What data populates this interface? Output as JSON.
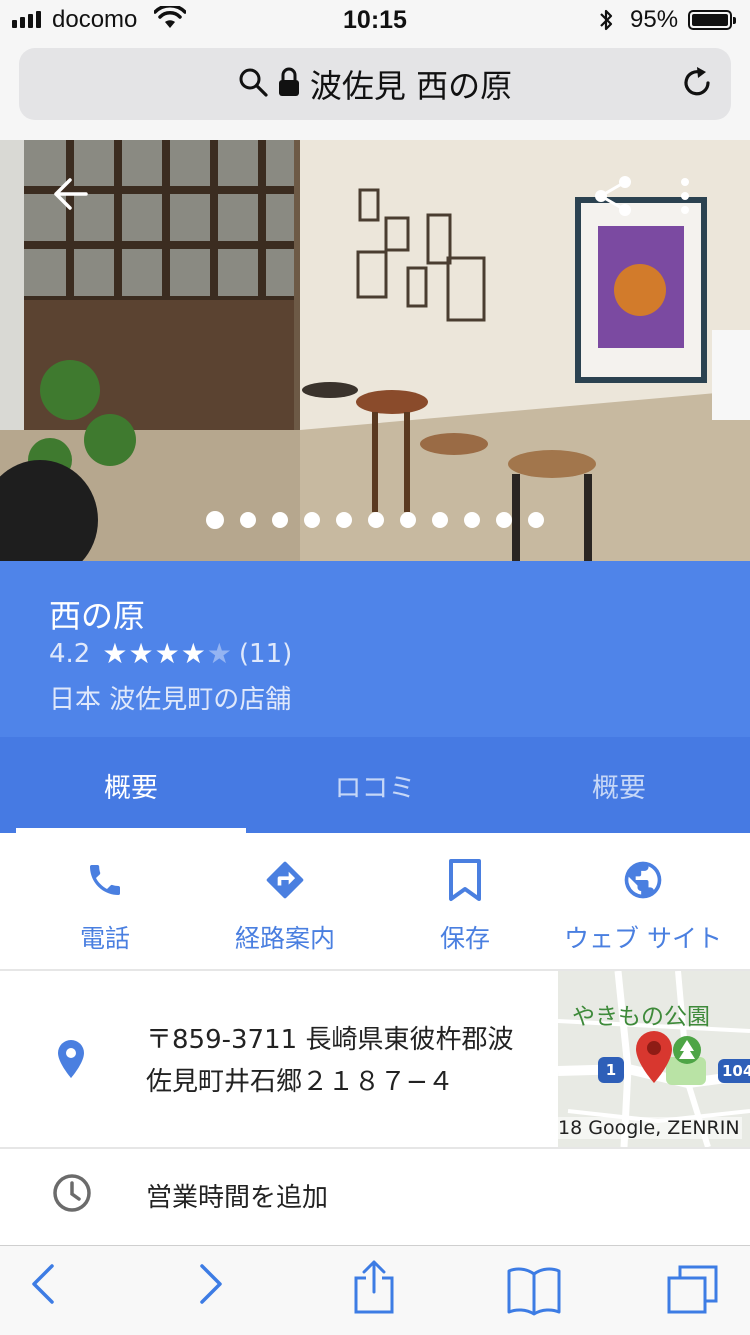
{
  "status_bar": {
    "carrier": "docomo",
    "time": "10:15",
    "battery_percent": "95%",
    "battery_level": 0.95,
    "icons": [
      "signal-icon",
      "wifi-icon",
      "bluetooth-icon",
      "battery-icon"
    ]
  },
  "address_bar": {
    "text": "波佐見 西の原",
    "icons": [
      "search-icon",
      "lock-icon",
      "reload-icon"
    ]
  },
  "hero": {
    "icons": [
      "back-arrow-icon",
      "share-icon",
      "more-vert-icon"
    ],
    "photo_count": 11,
    "active_photo_index": 0
  },
  "place": {
    "name": "西の原",
    "rating": "4.2",
    "rating_value": 4.2,
    "stars_filled": 4,
    "stars_total": 5,
    "review_count": "(11)",
    "category": "日本 波佐見町の店舗"
  },
  "tabs": [
    {
      "label": "概要",
      "active": true
    },
    {
      "label": "ロコミ",
      "active": false
    },
    {
      "label": "概要",
      "active": false
    }
  ],
  "actions": [
    {
      "label": "電話",
      "icon": "phone-icon"
    },
    {
      "label": "経路案内",
      "icon": "directions-icon"
    },
    {
      "label": "保存",
      "icon": "bookmark-icon"
    },
    {
      "label": "ウェブ サイト",
      "icon": "globe-icon"
    }
  ],
  "address": {
    "icon": "location-pin-icon",
    "line1": "〒859-3711 長崎県東彼杵郡波",
    "line2": "佐見町井石郷２１８７−４"
  },
  "map": {
    "label": "やきもの公園",
    "credit": "18 Google, ZENRIN",
    "route_1": "1",
    "route_2": "104",
    "pin_color": "#d8372f"
  },
  "hours": {
    "icon": "clock-icon",
    "text": "営業時間を追加"
  },
  "toolbar": {
    "icons": [
      "back-icon",
      "forward-icon",
      "share-icon",
      "bookmarks-icon",
      "tabs-icon"
    ]
  },
  "colors": {
    "panel": "#4f84e9",
    "tabs": "#467ae3",
    "accent": "#4a7fe0",
    "ios_blue": "#3d7ce4"
  }
}
